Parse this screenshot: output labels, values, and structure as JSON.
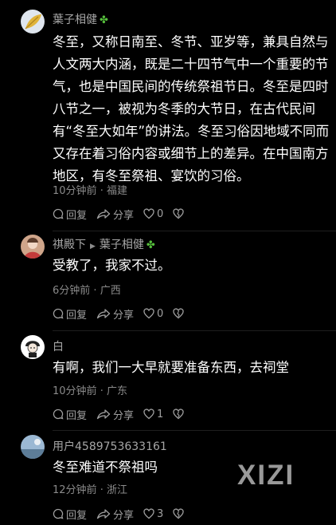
{
  "comments": [
    {
      "username": "葉子相健",
      "badge": "✤",
      "text": "冬至，又称日南至、冬节、亚岁等，兼具自然与人文两大内涵，既是二十四节气中一个重要的节气，也是中国民间的传统祭祖节日。冬至是四时八节之一，被视为冬季的大节日，在古代民间有“冬至大如年”的讲法。冬至习俗因地域不同而又存在着习俗内容或细节上的差异。在中国南方地区，有冬至祭祖、宴饮的习俗。",
      "time": "10分钟前",
      "location": "福建",
      "reply_label": "回复",
      "share_label": "分享",
      "likes": "0"
    },
    {
      "username": "祺殿下",
      "reply_to": "葉子相健",
      "badge": "✤",
      "text": "受教了，我家不过。",
      "time": "6分钟前",
      "location": "广西",
      "reply_label": "回复",
      "share_label": "分享",
      "likes": "0"
    },
    {
      "username": "白",
      "text": "有啊，我们一大早就要准备东西，去祠堂",
      "time": "10分钟前",
      "location": "广东",
      "reply_label": "回复",
      "share_label": "分享",
      "likes": "1"
    },
    {
      "username": "用户4589753633161",
      "text": "冬至难道不祭祖吗",
      "time": "12分钟前",
      "location": "浙江",
      "reply_label": "回复",
      "share_label": "分享",
      "likes": "3"
    }
  ],
  "separator": "·",
  "watermark": "XIZI",
  "colors": {
    "background": "#000000",
    "secondary_text": "#8a8a8a",
    "badge_green": "#56c03c"
  }
}
